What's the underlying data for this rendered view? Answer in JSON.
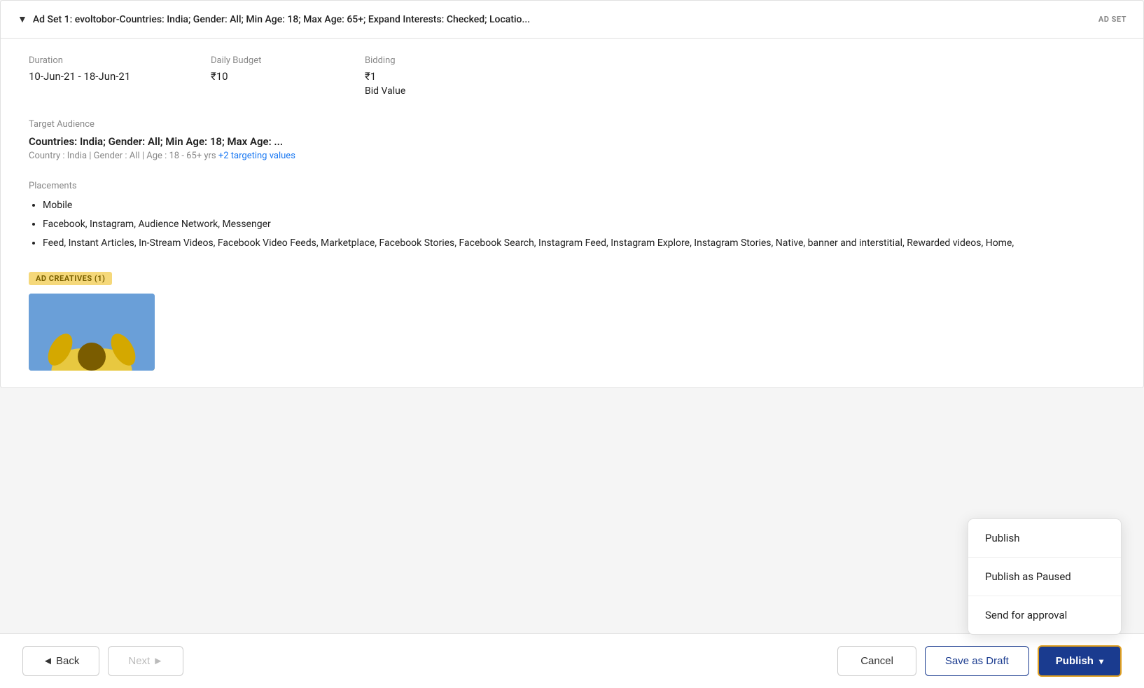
{
  "header": {
    "chevron": "▼",
    "title": "Ad Set 1: evoltobor-Countries: India; Gender: All; Min Age: 18; Max Age: 65+; Expand Interests: Checked; Locatio...",
    "badge": "AD SET"
  },
  "adset_details": {
    "duration_label": "Duration",
    "duration_value": "10-Jun-21 - 18-Jun-21",
    "daily_budget_label": "Daily Budget",
    "daily_budget_value": "₹10",
    "bidding_label": "Bidding",
    "bidding_value": "₹1",
    "bidding_sub": "Bid Value"
  },
  "target_audience": {
    "label": "Target Audience",
    "title": "Countries: India; Gender: All; Min Age: 18; Max Age: ...",
    "sub": "Country : India | Gender : All | Age : 18 - 65+ yrs",
    "link_text": "+2 targeting values"
  },
  "placements": {
    "label": "Placements",
    "items": [
      "Mobile",
      "Facebook, Instagram, Audience Network, Messenger",
      "Feed, Instant Articles, In-Stream Videos, Facebook Video Feeds, Marketplace, Facebook Stories, Facebook Search, Instagram Feed, Instagram Explore, Instagram Stories, Native, banner and interstitial, Rewarded videos, Home,"
    ]
  },
  "ad_creatives": {
    "badge": "AD CREATIVES (1)"
  },
  "footer": {
    "back_label": "◄ Back",
    "next_label": "Next ►",
    "cancel_label": "Cancel",
    "save_draft_label": "Save as Draft",
    "publish_label": "Publish",
    "publish_chevron": "▾"
  },
  "dropdown": {
    "items": [
      "Publish",
      "Publish as Paused",
      "Send for approval"
    ]
  }
}
